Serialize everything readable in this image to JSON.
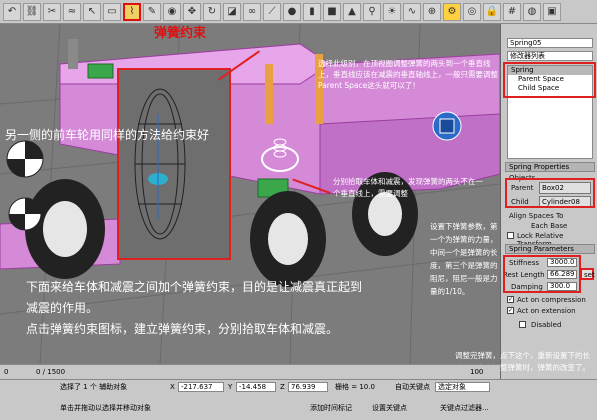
{
  "toolbar": {
    "callout_label": "弹簧约束"
  },
  "viewport": {
    "annotation_top": "选择此级别，在顶视图调整弹簧的两头到一个垂直线上，垂直线应该在减震的垂直轴线上，一般只需要调整Parent Space这头就可以了！",
    "annotation_left": "另一侧的前车轮用同样的方法给约束好",
    "annotation_mid": "分别拾取车体和减震，发现弹簧的两头不在一个垂直线上，需要调整",
    "annotation_bottom_1": "下面来给车体和减震之间加个弹簧约束，目的是让减震真正起到",
    "annotation_bottom_2": "减震的作用。",
    "annotation_bottom_3": "点击弹簧约束图标，建立弹簧约束，分别拾取车体和减震。",
    "annotation_right": "设置下弹簧参数，第一个为弹簧的力量，中间一个是弹簧的长度，第三个是弹簧的阻尼，阻尼一般是力量的1/10。",
    "annotation_bottom_right": "调整完弹簧，点下这个，重新设置下的长度，因为在调整弹簧时，弹簧的改变了。"
  },
  "panel": {
    "object_name": "Spring05",
    "modifier_list": "修改器列表",
    "stack": [
      "Spring",
      "Parent Space",
      "Child Space"
    ],
    "rollout_title": "Spring Properties",
    "objects_label": "Objects",
    "parent_label": "Parent",
    "parent_value": "Box02",
    "child_label": "Child",
    "child_value": "Cylinder08",
    "align_label": "Align Spaces To",
    "each_base_label": "Each Base",
    "lock_label": "Lock Relative Transform",
    "spring_params_label": "Spring Parameters",
    "stiffness_label": "Stiffness",
    "stiffness_value": "3000.0",
    "rest_length_label": "Rest Length",
    "rest_length_value": "66.289",
    "set_label": "set",
    "damping_label": "Damping",
    "damping_value": "300.0",
    "act_compression": "Act on compression",
    "act_extension": "Act on extension",
    "disabled_label": "Disabled"
  },
  "status": {
    "frame": "0 / 1500",
    "selected": "选择了 1 个 辅助对象",
    "hint": "单击并拖动以选择并移动对象",
    "x_value": "-217.637",
    "y_value": "-14.458",
    "z_value": "76.939",
    "grid": "栅格 = 10.0",
    "auto_key": "自动关键点",
    "select_object": "选定对象",
    "set_key": "设置关键点",
    "key_filter": "关键点过滤器...",
    "add_time_tag": "添加时间标记",
    "timeline_start": "0",
    "timeline_end": "100"
  }
}
